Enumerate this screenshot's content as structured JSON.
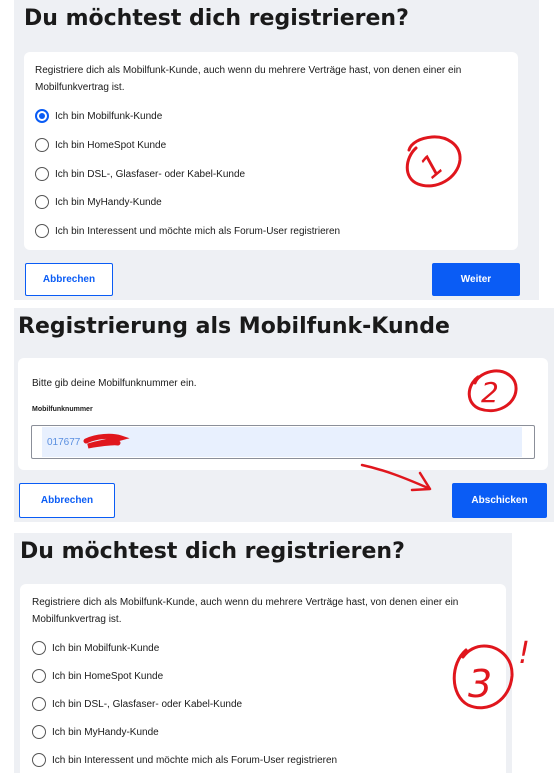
{
  "step1": {
    "title": "Du möchtest dich registrieren?",
    "description": "Registriere dich als Mobilfunk-Kunde, auch wenn du mehrere Verträge hast, von denen einer ein Mobilfunkvertrag ist.",
    "options": [
      {
        "label": "Ich bin Mobilfunk-Kunde",
        "selected": true
      },
      {
        "label": "Ich bin HomeSpot Kunde",
        "selected": false
      },
      {
        "label": "Ich bin DSL-, Glasfaser- oder Kabel-Kunde",
        "selected": false
      },
      {
        "label": "Ich bin MyHandy-Kunde",
        "selected": false
      },
      {
        "label": "Ich bin Interessent und möchte mich als Forum-User registrieren",
        "selected": false
      }
    ],
    "cancel_label": "Abbrechen",
    "next_label": "Weiter"
  },
  "step2": {
    "title": "Registrierung als Mobilfunk-Kunde",
    "prompt": "Bitte gib deine Mobilfunknummer ein.",
    "field_label": "Mobilfunknummer",
    "field_value": "017677",
    "cancel_label": "Abbrechen",
    "submit_label": "Abschicken"
  },
  "step3": {
    "title": "Du möchtest dich registrieren?",
    "description": "Registriere dich als Mobilfunk-Kunde, auch wenn du mehrere Verträge hast, von denen einer ein Mobilfunkvertrag ist.",
    "options": [
      {
        "label": "Ich bin Mobilfunk-Kunde",
        "selected": false
      },
      {
        "label": "Ich bin HomeSpot Kunde",
        "selected": false
      },
      {
        "label": "Ich bin DSL-, Glasfaser- oder Kabel-Kunde",
        "selected": false
      },
      {
        "label": "Ich bin MyHandy-Kunde",
        "selected": false
      },
      {
        "label": "Ich bin Interessent und möchte mich als Forum-User registrieren",
        "selected": false
      }
    ]
  },
  "annotations": [
    "1",
    "2",
    "3",
    "!"
  ],
  "colors": {
    "accent": "#0a5cf5",
    "panel_bg": "#eef0f4",
    "annotation": "#e0161d"
  }
}
